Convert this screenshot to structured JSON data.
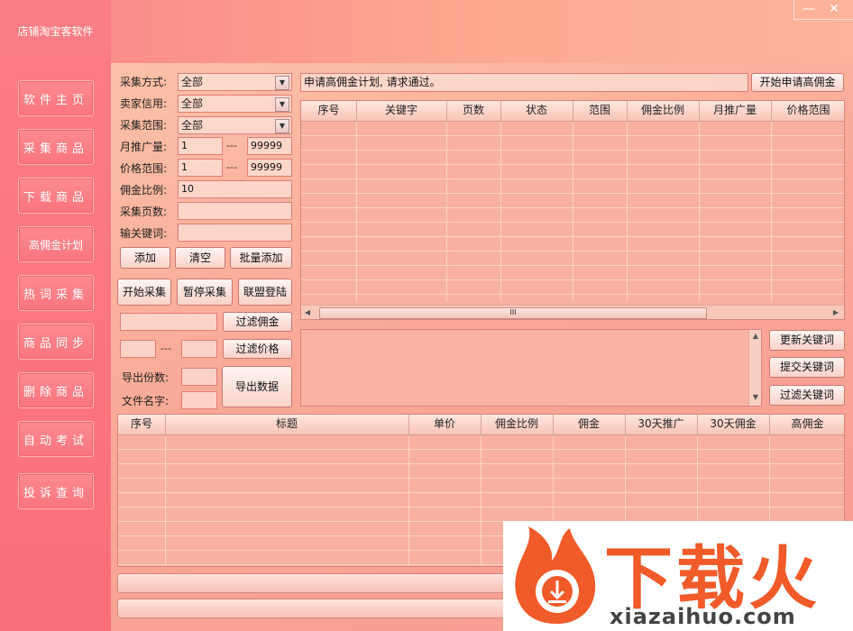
{
  "app": {
    "title": "店铺淘宝客软件",
    "minimize": "—",
    "close": "✕"
  },
  "sidebar": {
    "items": [
      {
        "label": "软件主页"
      },
      {
        "label": "采集商品"
      },
      {
        "label": "下载商品"
      },
      {
        "label": "高佣金计划"
      },
      {
        "label": "热词采集"
      },
      {
        "label": "商品同步"
      },
      {
        "label": "删除商品"
      },
      {
        "label": "自动考试"
      },
      {
        "label": "投诉查询"
      }
    ]
  },
  "form": {
    "collect_mode": {
      "label": "采集方式:",
      "value": "全部"
    },
    "seller_credit": {
      "label": "卖家信用:",
      "value": "全部"
    },
    "collect_range": {
      "label": "采集范围:",
      "value": "全部"
    },
    "monthly_promo": {
      "label": "月推广量:",
      "min": "1",
      "sep": "---",
      "max": "99999"
    },
    "price_range": {
      "label": "价格范围:",
      "min": "1",
      "sep": "---",
      "max": "99999"
    },
    "commission_ratio": {
      "label": "佣金比例:",
      "value": "10"
    },
    "pages": {
      "label": "采集页数:",
      "value": ""
    },
    "keyword": {
      "label": "输关键词:",
      "value": ""
    },
    "buttons": {
      "add": "添加",
      "clear": "清空",
      "batch_add": "批量添加",
      "start": "开始采集",
      "pause": "暂停采集",
      "alliance_login": "联盟登陆"
    },
    "filter_commission": {
      "value": "",
      "button": "过滤佣金"
    },
    "filter_price": {
      "min": "",
      "sep": "---",
      "max": "",
      "button": "过滤价格"
    },
    "export_count": {
      "label": "导出份数:",
      "value": ""
    },
    "file_name": {
      "label": "文件名字:",
      "value": ""
    },
    "export_button": "导出数据"
  },
  "apply": {
    "message": "申请高佣金计划, 请求通过。",
    "button": "开始申请高佣金"
  },
  "keyword_table": {
    "columns": [
      "序号",
      "关键字",
      "页数",
      "状态",
      "范围",
      "佣金比例",
      "月推广量",
      "价格范围"
    ]
  },
  "keyword_panel": {
    "buttons": {
      "update": "更新关键词",
      "submit": "提交关键词",
      "filter": "过滤关键词"
    }
  },
  "scroll": {
    "thumb_grip": "III"
  },
  "product_table": {
    "columns": [
      "序号",
      "标题",
      "单价",
      "佣金比例",
      "佣金",
      "30天推广",
      "30天佣金",
      "高佣金"
    ]
  },
  "watermark": {
    "brand": "下载火",
    "url": "xiazaihuo.com"
  }
}
